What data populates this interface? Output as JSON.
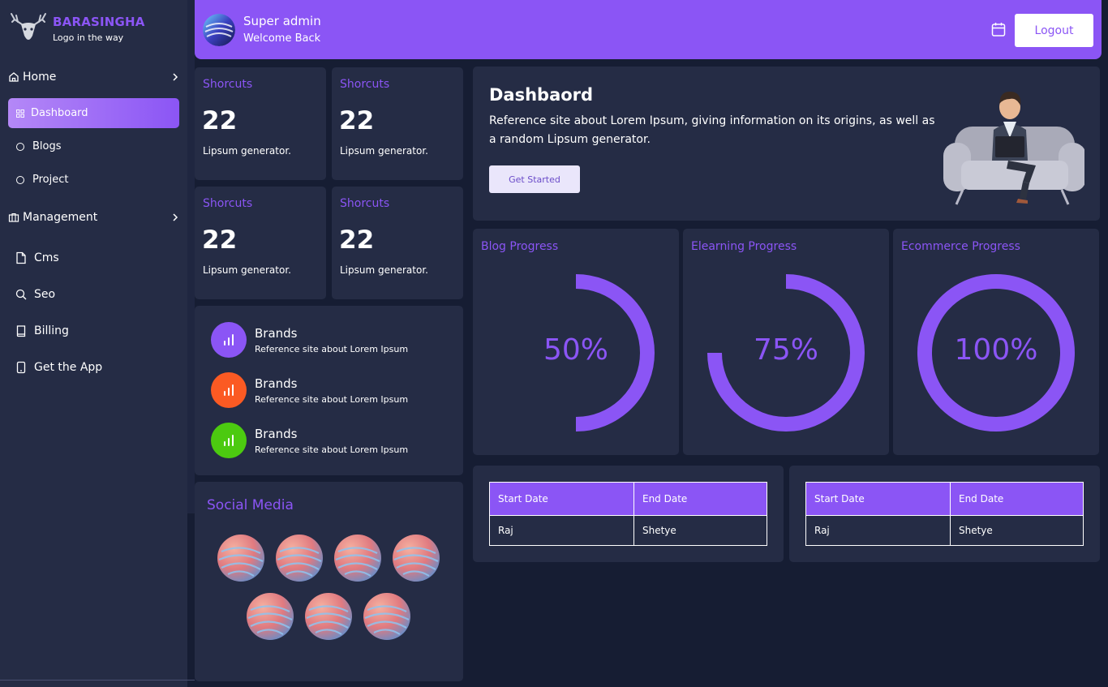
{
  "brand": {
    "title": "BARASINGHA",
    "subtitle": "Logo in the way",
    "logo_icon": "deer-logo-icon"
  },
  "sidebar": {
    "home": "Home",
    "items": [
      {
        "label": "Dashboard",
        "active": true,
        "icon": "grid-icon"
      },
      {
        "label": "Blogs",
        "active": false,
        "icon": "circle-icon"
      },
      {
        "label": "Project",
        "active": false,
        "icon": "circle-icon"
      }
    ],
    "management": "Management",
    "links": [
      {
        "label": "Cms",
        "icon": "file-icon"
      },
      {
        "label": "Seo",
        "icon": "search-icon"
      },
      {
        "label": "Billing",
        "icon": "book-icon"
      },
      {
        "label": "Get the App",
        "icon": "phone-icon"
      }
    ]
  },
  "header": {
    "name": "Super admin",
    "welcome": "Welcome Back",
    "logout": "Logout",
    "calendar_icon": "calendar-icon"
  },
  "shortcuts": [
    {
      "title": "Shorcuts",
      "value": "22",
      "desc": "Lipsum generator."
    },
    {
      "title": "Shorcuts",
      "value": "22",
      "desc": "Lipsum generator."
    },
    {
      "title": "Shorcuts",
      "value": "22",
      "desc": "Lipsum generator."
    },
    {
      "title": "Shorcuts",
      "value": "22",
      "desc": "Lipsum generator."
    }
  ],
  "brands": [
    {
      "title": "Brands",
      "sub": "Reference site about Lorem Ipsum",
      "color": "#8b55f5"
    },
    {
      "title": "Brands",
      "sub": "Reference site about Lorem Ipsum",
      "color": "#fb5a23"
    },
    {
      "title": "Brands",
      "sub": "Reference site about Lorem Ipsum",
      "color": "#4cca10"
    }
  ],
  "social": {
    "title": "Social Media",
    "count": 7
  },
  "hero": {
    "title": "Dashbaord",
    "desc": "Reference site about Lorem Ipsum, giving information on its origins, as well as a random Lipsum generator.",
    "button": "Get Started"
  },
  "progress": [
    {
      "title": "Blog Progress",
      "label": "50%",
      "value": 50
    },
    {
      "title": "Elearning Progress",
      "label": "75%",
      "value": 75
    },
    {
      "title": "Ecommerce Progress",
      "label": "100%",
      "value": 100
    }
  ],
  "tables": [
    {
      "headers": [
        "Start Date",
        "End Date"
      ],
      "rows": [
        [
          "Raj",
          "Shetye"
        ]
      ]
    },
    {
      "headers": [
        "Start Date",
        "End Date"
      ],
      "rows": [
        [
          "Raj",
          "Shetye"
        ]
      ]
    }
  ],
  "colors": {
    "accent": "#8b55f5",
    "panel": "#252c45",
    "bg": "#161d33"
  }
}
